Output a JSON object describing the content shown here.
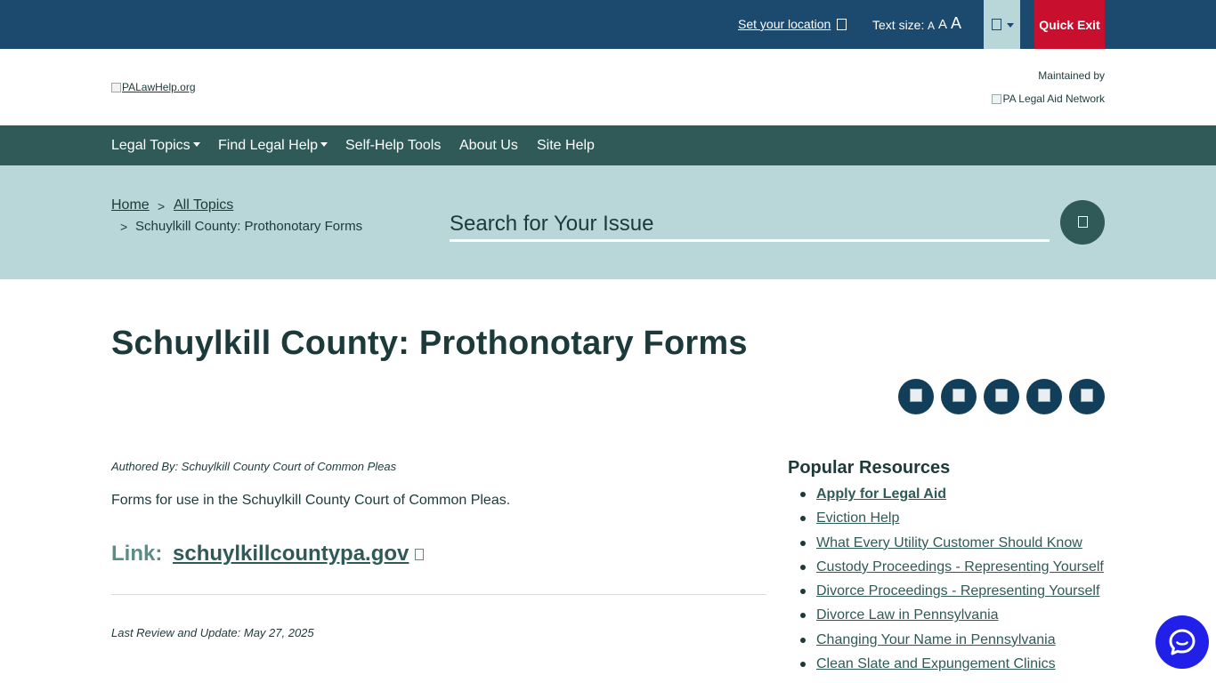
{
  "utility": {
    "set_location": "Set your location",
    "text_size_label": "Text size:",
    "text_size_options": [
      "A",
      "A",
      "A"
    ],
    "quick_exit": "Quick Exit",
    "language_icon": "globe-icon"
  },
  "header": {
    "logo_alt": "PALawHelp.org",
    "maintained_by": "Maintained by",
    "partner_alt": "PA Legal Aid Network"
  },
  "nav": {
    "items": [
      {
        "label": "Legal Topics",
        "has_menu": true
      },
      {
        "label": "Find Legal Help",
        "has_menu": true
      },
      {
        "label": "Self-Help Tools",
        "has_menu": false
      },
      {
        "label": "About Us",
        "has_menu": false
      },
      {
        "label": "Site Help",
        "has_menu": false
      }
    ]
  },
  "breadcrumb": {
    "separator": ">",
    "home": "Home",
    "all_topics": "All Topics",
    "current": "Schuylkill County: Prothonotary Forms"
  },
  "search": {
    "placeholder": "Search for Your Issue",
    "button_icon": "search-icon"
  },
  "page": {
    "title": "Schuylkill County: Prothonotary Forms",
    "share_buttons": [
      "print-icon",
      "email-icon",
      "facebook-icon",
      "twitter-icon",
      "linkedin-icon"
    ],
    "author": "Authored By: Schuylkill County Court of Common Pleas",
    "description": "Forms for use in the Schuylkill County Court of Common Pleas.",
    "link_label": "Link:",
    "link_text": "schuylkillcountypa.gov",
    "last_review": "Last Review and Update: May 27, 2025"
  },
  "popular": {
    "title": "Popular Resources",
    "items": [
      {
        "label": "Apply for Legal Aid",
        "featured": true
      },
      {
        "label": "Eviction Help",
        "featured": false
      },
      {
        "label": "What Every Utility Customer Should Know",
        "featured": false
      },
      {
        "label": "Custody Proceedings - Representing Yourself",
        "featured": false
      },
      {
        "label": "Divorce Proceedings - Representing Yourself",
        "featured": false
      },
      {
        "label": "Divorce Law in Pennsylvania",
        "featured": false
      },
      {
        "label": "Changing Your Name in Pennsylvania",
        "featured": false
      },
      {
        "label": "Clean Slate and Expungement Clinics",
        "featured": false
      }
    ]
  },
  "colors": {
    "utility_bar": "#1b4a6e",
    "nav_bar": "#2f5a57",
    "search_band": "#b9d6d8",
    "quick_exit": "#c8102e",
    "chat_button": "#2020e8",
    "share_button": "#123e5a"
  },
  "chat": {
    "icon": "chat-bubble-icon"
  }
}
